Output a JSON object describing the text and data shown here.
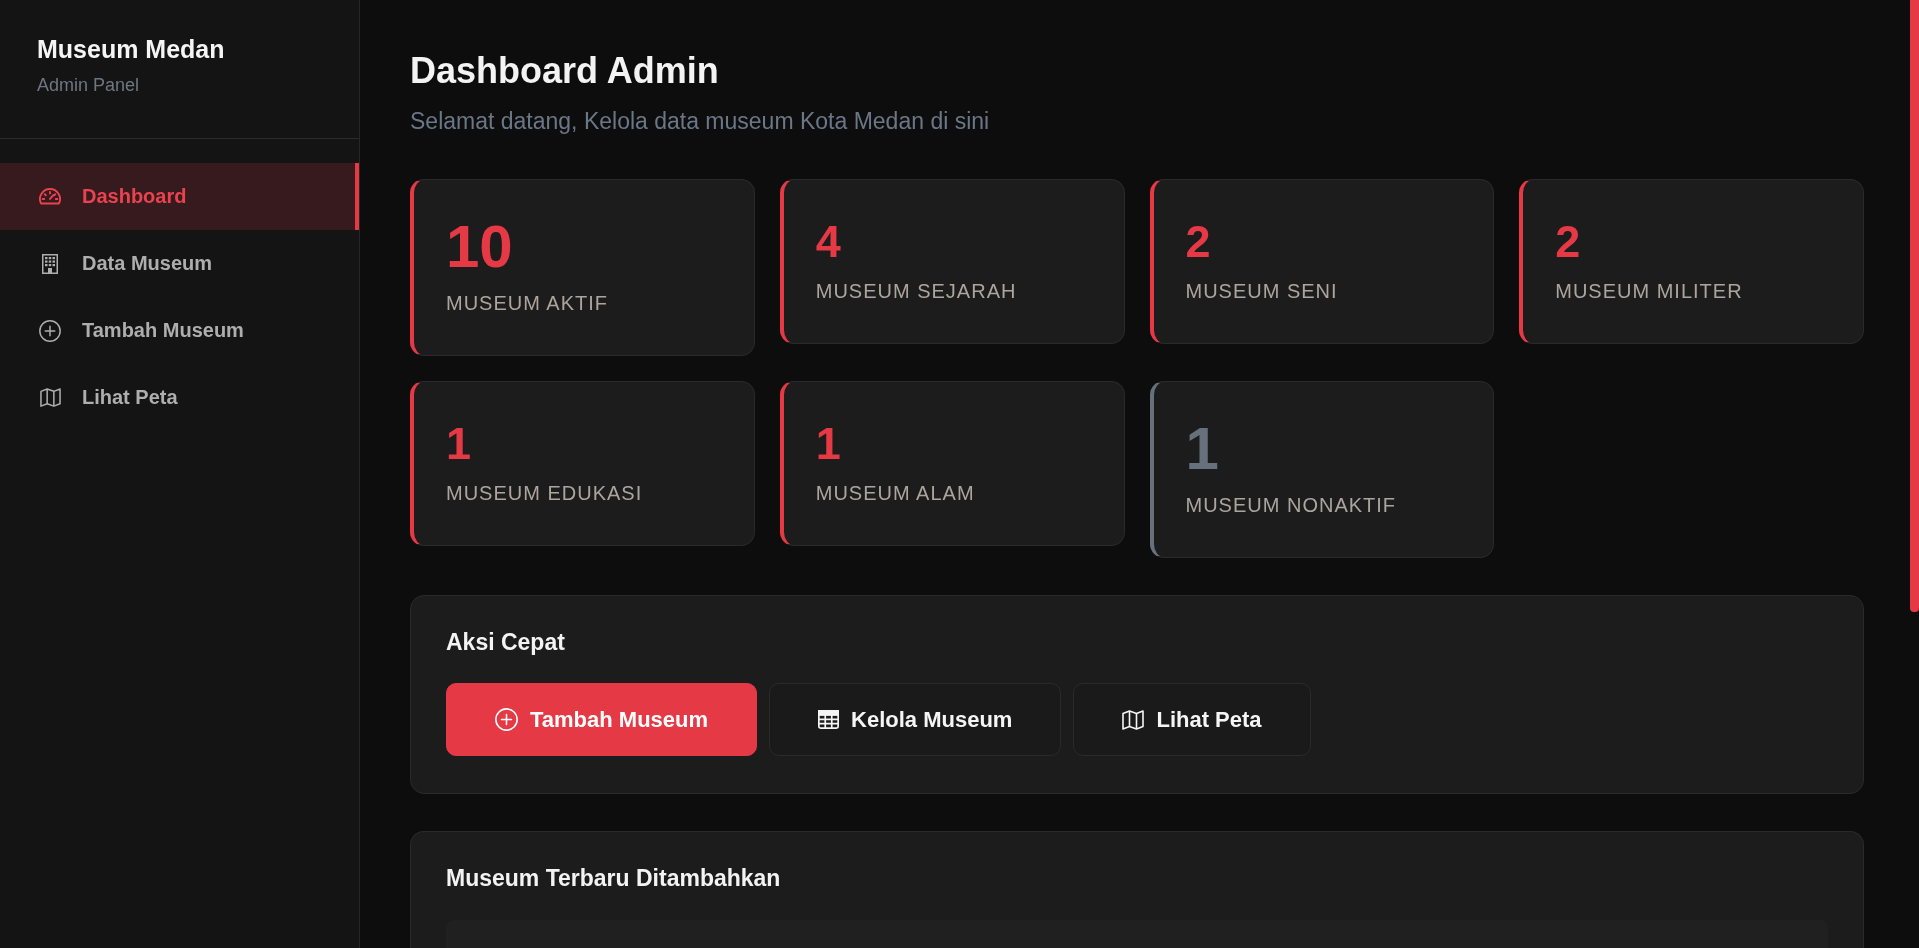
{
  "sidebar": {
    "title": "Museum Medan",
    "subtitle": "Admin Panel",
    "items": [
      {
        "label": "Dashboard",
        "selected": true
      },
      {
        "label": "Data Museum",
        "selected": false
      },
      {
        "label": "Tambah Museum",
        "selected": false
      },
      {
        "label": "Lihat Peta",
        "selected": false
      }
    ]
  },
  "header": {
    "title": "Dashboard Admin",
    "subtitle": "Selamat datang, Kelola data museum Kota Medan di sini"
  },
  "stats": [
    {
      "kind": "primary",
      "value": "10",
      "label": "MUSEUM AKTIF"
    },
    {
      "kind": "category",
      "value": "4",
      "label": "MUSEUM SEJARAH"
    },
    {
      "kind": "category",
      "value": "2",
      "label": "MUSEUM SENI"
    },
    {
      "kind": "category",
      "value": "2",
      "label": "MUSEUM MILITER"
    },
    {
      "kind": "category",
      "value": "1",
      "label": "MUSEUM EDUKASI"
    },
    {
      "kind": "category",
      "value": "1",
      "label": "MUSEUM ALAM"
    },
    {
      "kind": "inactive",
      "value": "1",
      "label": "MUSEUM NONAKTIF"
    }
  ],
  "quick_actions": {
    "title": "Aksi Cepat",
    "buttons": [
      {
        "kind": "primary",
        "label": "Tambah Museum"
      },
      {
        "kind": "secondary",
        "label": "Kelola Museum"
      },
      {
        "kind": "secondary",
        "label": "Lihat Peta"
      }
    ]
  },
  "recent": {
    "title": "Museum Terbaru Ditambahkan"
  }
}
